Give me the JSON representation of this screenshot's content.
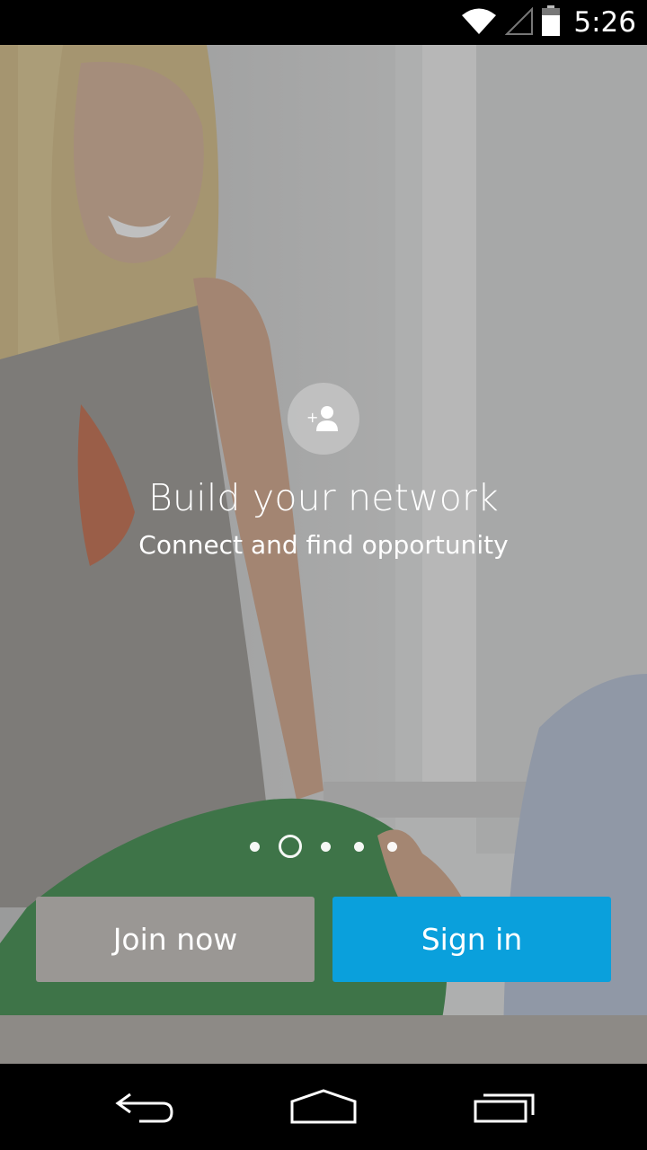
{
  "status_bar": {
    "time": "5:26",
    "icons": [
      "wifi-icon",
      "cell-signal-icon",
      "battery-icon"
    ]
  },
  "onboarding": {
    "icon": "add-connection-icon",
    "title": "Build your network",
    "subtitle": "Connect and find opportunity",
    "pager": {
      "page_count": 5,
      "active_index": 1
    }
  },
  "actions": {
    "join_label": "Join now",
    "signin_label": "Sign in"
  },
  "nav_bar": {
    "buttons": [
      "back-icon",
      "home-icon",
      "recent-apps-icon"
    ]
  },
  "colors": {
    "join_button": "#9a9794",
    "signin_button": "#0aa0dc",
    "bars": "#000000"
  }
}
